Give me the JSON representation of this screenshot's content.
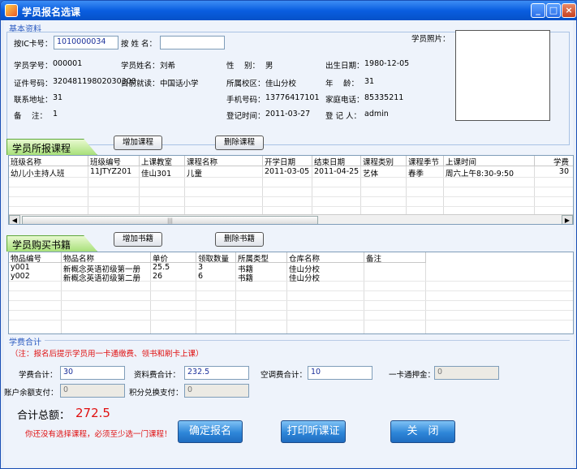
{
  "window": {
    "title": "学员报名选课"
  },
  "basic": {
    "section_label": "基本资料",
    "card_label": "按IC卡号：",
    "card_value": "1010000034",
    "name_search_label": "按 姓 名：",
    "name_search_value": "",
    "photo_label": "学员照片：",
    "fields": [
      {
        "label": "学员学号：",
        "value": "000001"
      },
      {
        "label": "学员姓名：",
        "value": "刘希"
      },
      {
        "label": "性　 别：",
        "value": "男"
      },
      {
        "label": "出生日期：",
        "value": "1980-12-05"
      },
      {
        "label": "证件号码：",
        "value": "32048119802030300"
      },
      {
        "label": "目前就读：",
        "value": "中国话小学"
      },
      {
        "label": "所属校区：",
        "value": "佳山分校"
      },
      {
        "label": "年　 龄：",
        "value": "31"
      },
      {
        "label": "联系地址：",
        "value": "31"
      },
      {
        "label": "手机号码：",
        "value": "13776417101"
      },
      {
        "label": "家庭电话：",
        "value": "85335211"
      },
      {
        "label": "备　 注：",
        "value": "1"
      },
      {
        "label": "登记时间：",
        "value": "2011-03-27"
      },
      {
        "label": "登 记 人：",
        "value": "admin"
      }
    ]
  },
  "courses": {
    "tab_label": "学员所报课程",
    "add_button": "增加课程",
    "delete_button": "删除课程",
    "columns": [
      "班级名称",
      "班级编号",
      "上课教室",
      "课程名称",
      "开学日期",
      "结束日期",
      "课程类别",
      "课程季节",
      "上课时间",
      "学费"
    ],
    "rows": [
      [
        "幼儿小主持人班",
        "11JTYZ201",
        "佳山301",
        "儿童",
        "2011-03-05",
        "2011-04-25",
        "艺体",
        "春季",
        "周六上午8:30-9:50",
        "30"
      ]
    ]
  },
  "books": {
    "tab_label": "学员购买书籍",
    "add_button": "增加书籍",
    "delete_button": "删除书籍",
    "columns": [
      "物品编号",
      "物品名称",
      "单价",
      "领取数量",
      "所属类型",
      "仓库名称",
      "备注"
    ],
    "rows": [
      [
        "y001",
        "新概念英语初级第一册",
        "25.5",
        "3",
        "书籍",
        "佳山分校",
        ""
      ],
      [
        "y002",
        "新概念英语初级第二册",
        "26",
        "6",
        "书籍",
        "佳山分校",
        ""
      ]
    ]
  },
  "fees": {
    "section_label": "学费合计",
    "note": "（注：报名后提示学员用一卡通缴费、领书和刷卡上课）",
    "tuition_label": "学费合计：",
    "tuition_value": "30",
    "material_label": "资料费合计：",
    "material_value": "232.5",
    "ac_label": "空调费合计：",
    "ac_value": "10",
    "deposit_label": "一卡通押金：",
    "deposit_value": "0",
    "balance_label": "账户余额支付：",
    "balance_value": "0",
    "points_label": "积分兑换支付：",
    "points_value": "0",
    "total_label": "合计总额：",
    "total_value": "272.5",
    "warning": "你还没有选择课程，必须至少选一门课程！",
    "confirm_button": "确定报名",
    "print_button": "打印听课证",
    "close_button": "关　闭"
  }
}
